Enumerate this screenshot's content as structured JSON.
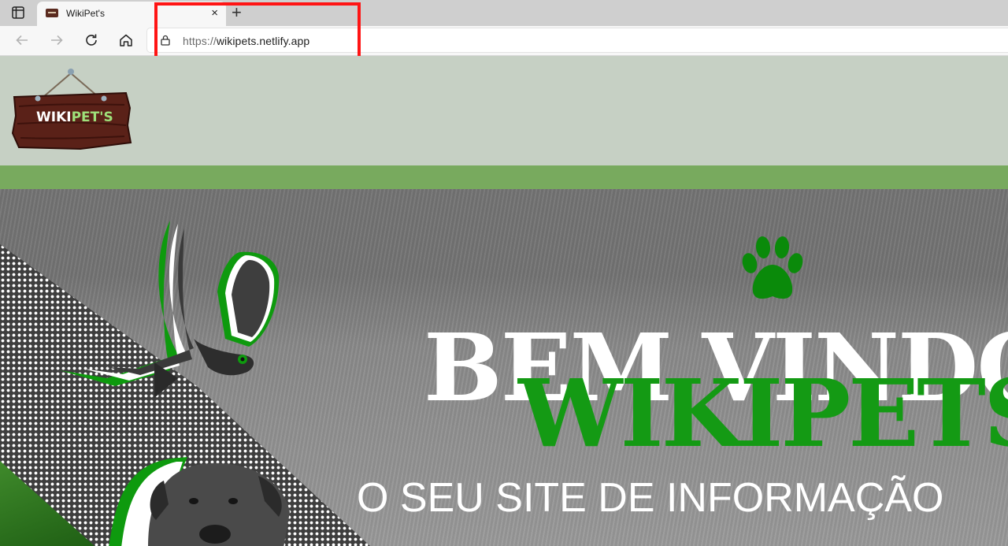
{
  "browser": {
    "tab": {
      "title": "WikiPet's",
      "close": "×"
    },
    "new_tab": "+",
    "address": {
      "scheme": "https://",
      "host": "wikipets.netlify.app"
    },
    "icons": [
      "tab-actions-icon",
      "back-arrow-icon",
      "forward-arrow-icon",
      "refresh-icon",
      "home-icon",
      "lock-icon"
    ]
  },
  "page": {
    "logo": {
      "text_white": "WIKI",
      "text_green": "PET'S"
    },
    "hero": {
      "greeting": "BEM VINDO",
      "brand": "WIKIPETS",
      "tagline": "O SEU SITE DE INFORMAÇÃO"
    }
  },
  "colors": {
    "header_bg": "#c6d0c4",
    "green_bar": "#78aa5e",
    "brand_green": "#149a14",
    "highlight_box": "#ff1414"
  }
}
